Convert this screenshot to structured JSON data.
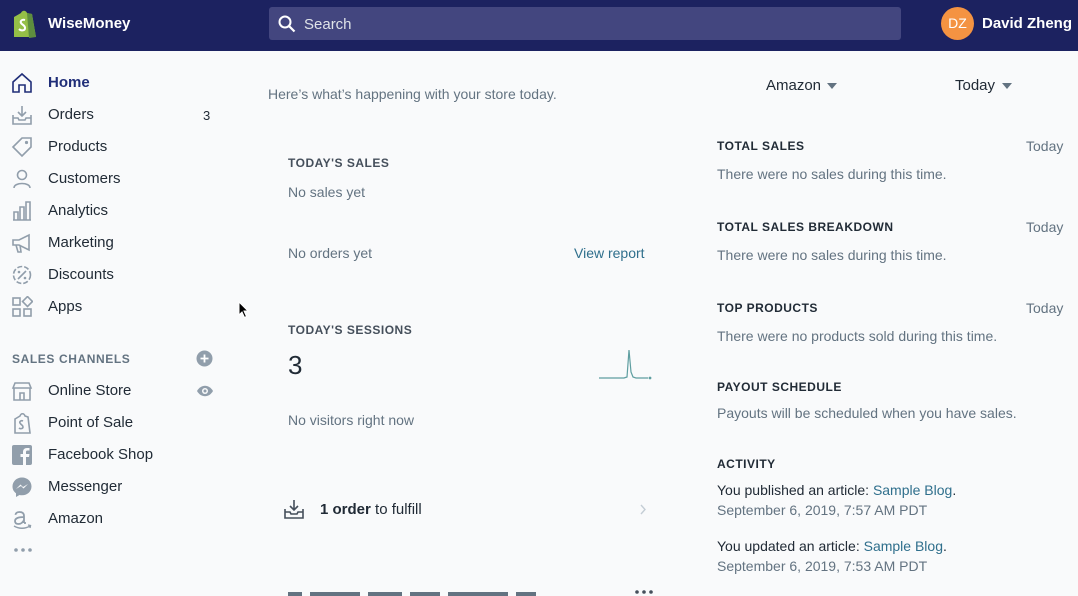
{
  "topbar": {
    "app_name": "WiseMoney",
    "search_placeholder": "Search",
    "user_initials": "DZ",
    "user_name": "David Zheng"
  },
  "sidebar": {
    "items": [
      {
        "label": "Home",
        "icon": "home-icon",
        "active": true
      },
      {
        "label": "Orders",
        "icon": "orders-icon",
        "badge": "3"
      },
      {
        "label": "Products",
        "icon": "tag-icon"
      },
      {
        "label": "Customers",
        "icon": "person-icon"
      },
      {
        "label": "Analytics",
        "icon": "bar-chart-icon"
      },
      {
        "label": "Marketing",
        "icon": "megaphone-icon"
      },
      {
        "label": "Discounts",
        "icon": "discount-icon"
      },
      {
        "label": "Apps",
        "icon": "apps-icon"
      }
    ],
    "sales_channels_title": "SALES CHANNELS",
    "channels": [
      {
        "label": "Online Store",
        "icon": "store-icon"
      },
      {
        "label": "Point of Sale",
        "icon": "shopify-bag-icon"
      },
      {
        "label": "Facebook Shop",
        "icon": "facebook-icon"
      },
      {
        "label": "Messenger",
        "icon": "messenger-icon"
      },
      {
        "label": "Amazon",
        "icon": "amazon-icon"
      }
    ]
  },
  "main": {
    "greeting": "Here’s what’s happening with your store today.",
    "channel_filter": "Amazon",
    "date_filter": "Today",
    "todays_sales": {
      "title": "TODAY'S SALES",
      "status": "No sales yet",
      "orders_status": "No orders yet",
      "view_report": "View report"
    },
    "todays_sessions": {
      "title": "TODAY'S SESSIONS",
      "count": "3",
      "visitors": "No visitors right now"
    },
    "fulfill": {
      "count_label": "1 order",
      "suffix": " to fulfill"
    }
  },
  "right": {
    "total_sales": {
      "title": "TOTAL SALES",
      "when": "Today",
      "text": "There were no sales during this time."
    },
    "breakdown": {
      "title": "TOTAL SALES BREAKDOWN",
      "when": "Today",
      "text": "There were no sales during this time."
    },
    "top_products": {
      "title": "TOP PRODUCTS",
      "when": "Today",
      "text": "There were no products sold during this time."
    },
    "payout": {
      "title": "PAYOUT SCHEDULE",
      "text": "Payouts will be scheduled when you have sales."
    },
    "activity": {
      "title": "ACTIVITY",
      "entries": [
        {
          "text": "You published an article: ",
          "link": "Sample Blog",
          "tail": ".",
          "date": "September 6, 2019, 7:57 AM PDT"
        },
        {
          "text": "You updated an article: ",
          "link": "Sample Blog",
          "tail": ".",
          "date": "September 6, 2019, 7:53 AM PDT"
        }
      ]
    }
  },
  "colors": {
    "topbar": "#1c2260",
    "search_bg": "#43467f",
    "avatar": "#f49342",
    "link": "#2f6f8c",
    "logo_green": "#95bf47"
  }
}
